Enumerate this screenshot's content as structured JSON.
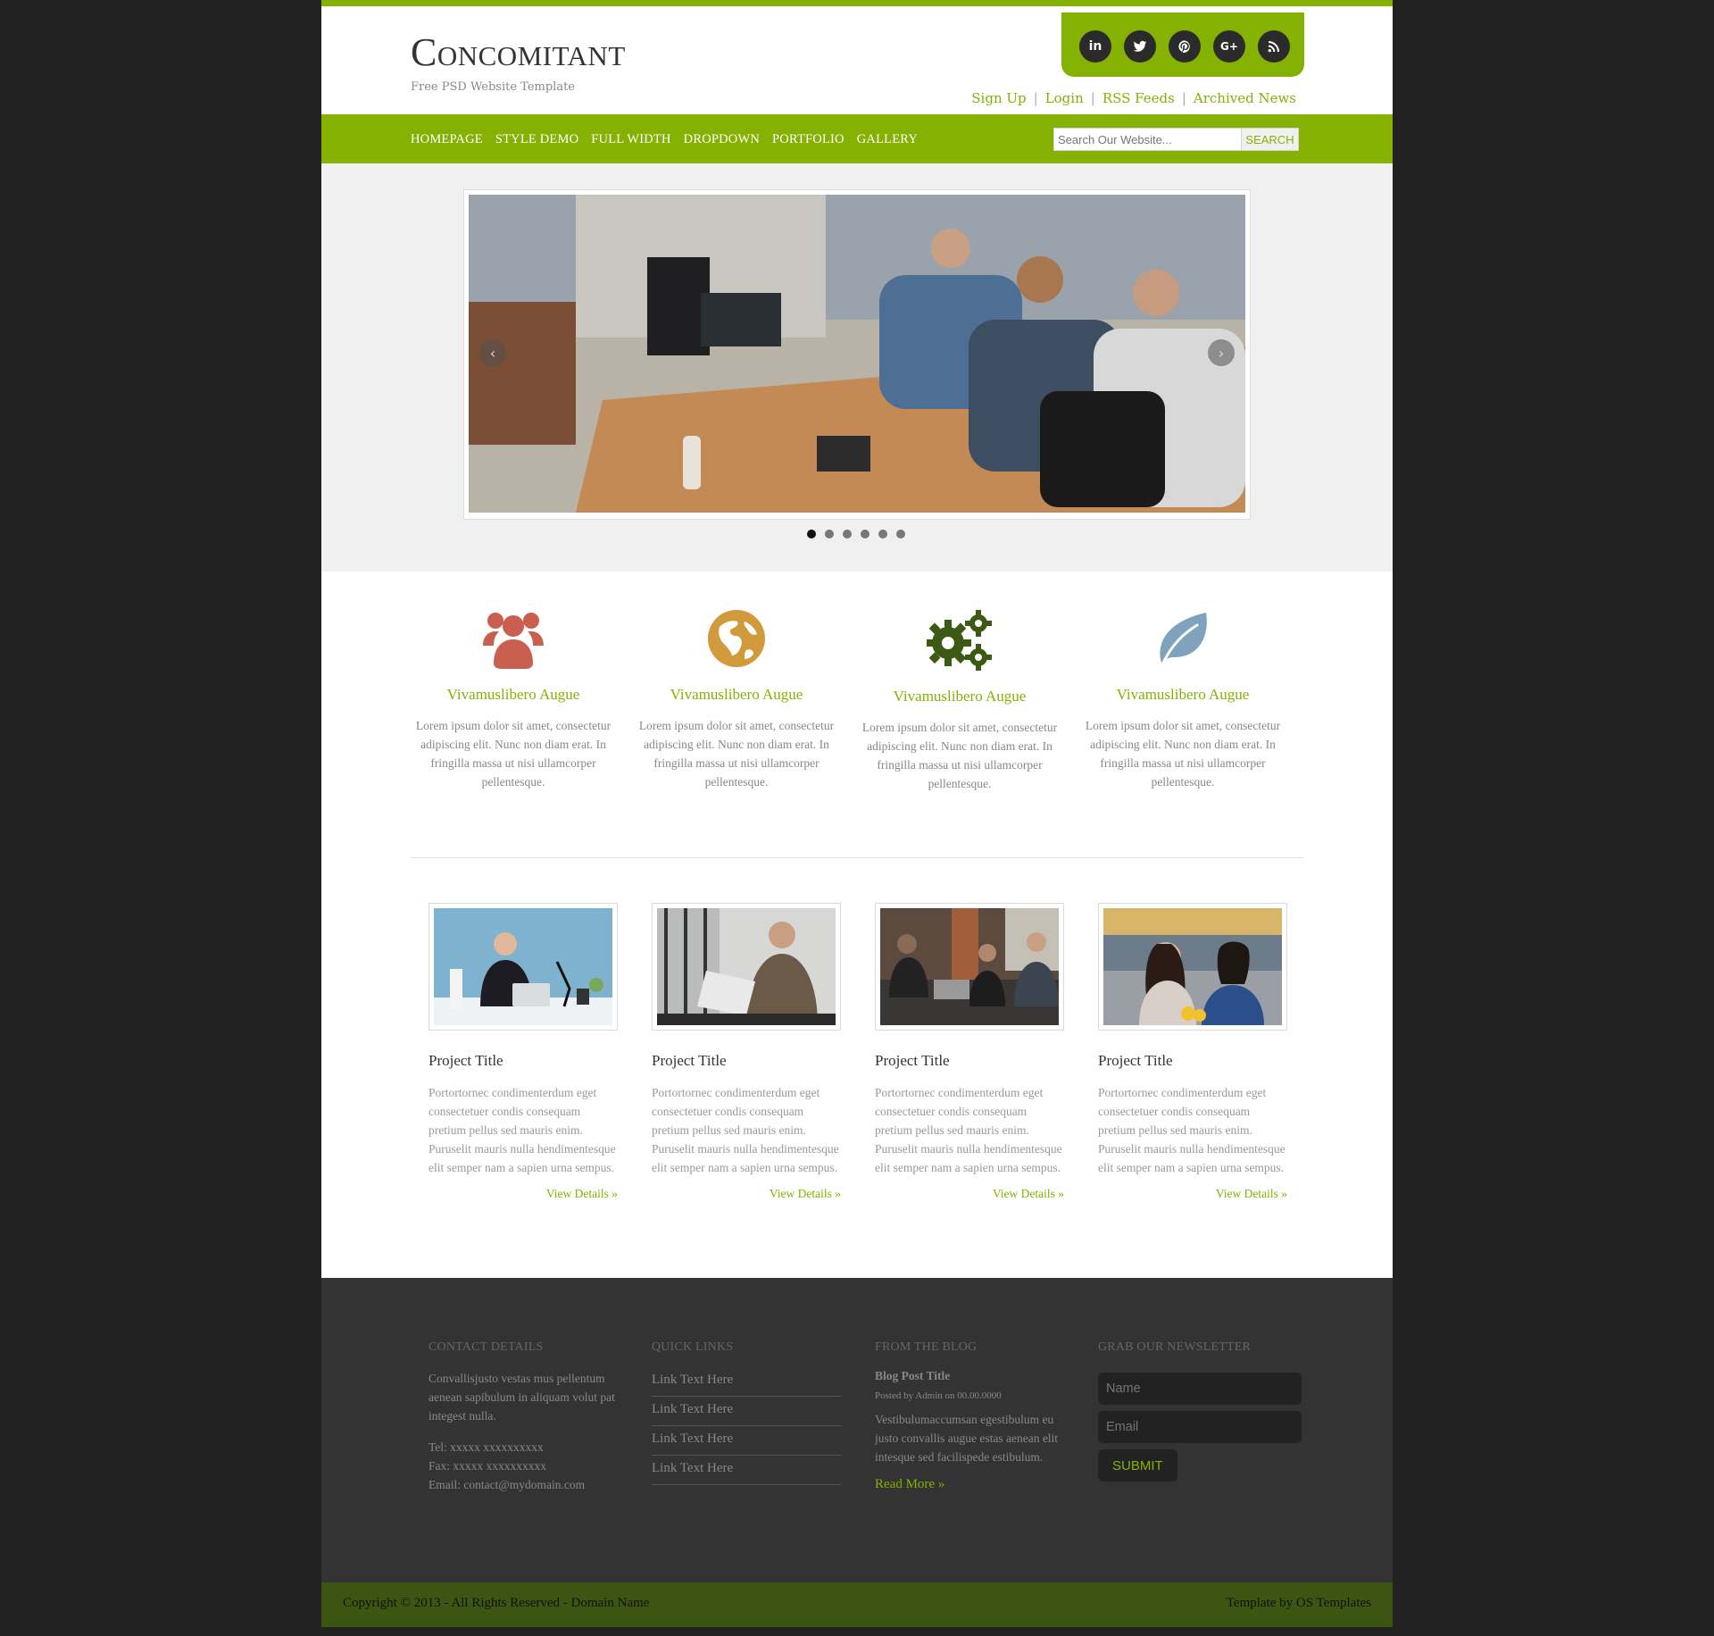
{
  "brand": {
    "title_first": "C",
    "title_rest": "oncomitant",
    "subtitle": "Free PSD Website Template",
    "accent_color": "#85b202"
  },
  "social": [
    "linkedin-icon",
    "twitter-icon",
    "pinterest-icon",
    "google-plus-icon",
    "rss-icon"
  ],
  "top_links": [
    "Sign Up",
    "Login",
    "RSS Feeds",
    "Archived News"
  ],
  "nav": [
    "Homepage",
    "Style Demo",
    "Full Width",
    "Dropdown",
    "Portfolio",
    "Gallery"
  ],
  "search": {
    "placeholder": "Search Our Website...",
    "button": "SEARCH"
  },
  "slider": {
    "prev": "‹",
    "next": "›",
    "dots": 6,
    "active_dot": 1
  },
  "features": [
    {
      "icon": "users-icon",
      "color": "#c9604f",
      "title": "Vivamuslibero Augue",
      "text": "Lorem ipsum dolor sit amet, consectetur adipiscing elit. Nunc non diam erat. In fringilla massa ut nisi ullamcorper pellentesque."
    },
    {
      "icon": "globe-icon",
      "color": "#d19a3b",
      "title": "Vivamuslibero Augue",
      "text": "Lorem ipsum dolor sit amet, consectetur adipiscing elit. Nunc non diam erat. In fringilla massa ut nisi ullamcorper pellentesque."
    },
    {
      "icon": "gears-icon",
      "color": "#3d5a14",
      "title": "Vivamuslibero Augue",
      "text": "Lorem ipsum dolor sit amet, consectetur adipiscing elit. Nunc non diam erat. In fringilla massa ut nisi ullamcorper pellentesque."
    },
    {
      "icon": "leaf-icon",
      "color": "#7fa3bd",
      "title": "Vivamuslibero Augue",
      "text": "Lorem ipsum dolor sit amet, consectetur adipiscing elit. Nunc non diam erat. In fringilla massa ut nisi ullamcorper pellentesque."
    }
  ],
  "projects": [
    {
      "title": "Project Title",
      "text": "Portortornec condimenterdum eget consectetuer condis consequam pretium pellus sed mauris enim. Puruselit mauris nulla hendimentesque elit semper nam a sapien urna sempus.",
      "more": "View Details »"
    },
    {
      "title": "Project Title",
      "text": "Portortornec condimenterdum eget consectetuer condis consequam pretium pellus sed mauris enim. Puruselit mauris nulla hendimentesque elit semper nam a sapien urna sempus.",
      "more": "View Details »"
    },
    {
      "title": "Project Title",
      "text": "Portortornec condimenterdum eget consectetuer condis consequam pretium pellus sed mauris enim. Puruselit mauris nulla hendimentesque elit semper nam a sapien urna sempus.",
      "more": "View Details »"
    },
    {
      "title": "Project Title",
      "text": "Portortornec condimenterdum eget consectetuer condis consequam pretium pellus sed mauris enim. Puruselit mauris nulla hendimentesque elit semper nam a sapien urna sempus.",
      "more": "View Details »"
    }
  ],
  "footer": {
    "contact": {
      "heading": "Contact Details",
      "text": "Convallisjusto vestas mus pellentum aenean sapibulum in aliquam volut pat integest nulla.",
      "tel": "Tel: xxxxx xxxxxxxxxx",
      "fax": "Fax: xxxxx xxxxxxxxxx",
      "email": "Email: contact@mydomain.com"
    },
    "quick_links": {
      "heading": "Quick Links",
      "links": [
        "Link Text Here",
        "Link Text Here",
        "Link Text Here",
        "Link Text Here"
      ]
    },
    "blog": {
      "heading": "From The Blog",
      "post_title": "Blog Post Title",
      "meta": "Posted by Admin on 00.00.0000",
      "text": "Vestibulumaccumsan egestibulum eu justo convallis augue estas aenean elit intesque sed facilispede estibulum.",
      "more": "Read More »"
    },
    "newsletter": {
      "heading": "Grab Our Newsletter",
      "name_placeholder": "Name",
      "email_placeholder": "Email",
      "submit": "SUBMIT"
    }
  },
  "copyright": {
    "left": "Copyright © 2013 - All Rights Reserved - Domain Name",
    "right": "Template by OS Templates"
  }
}
